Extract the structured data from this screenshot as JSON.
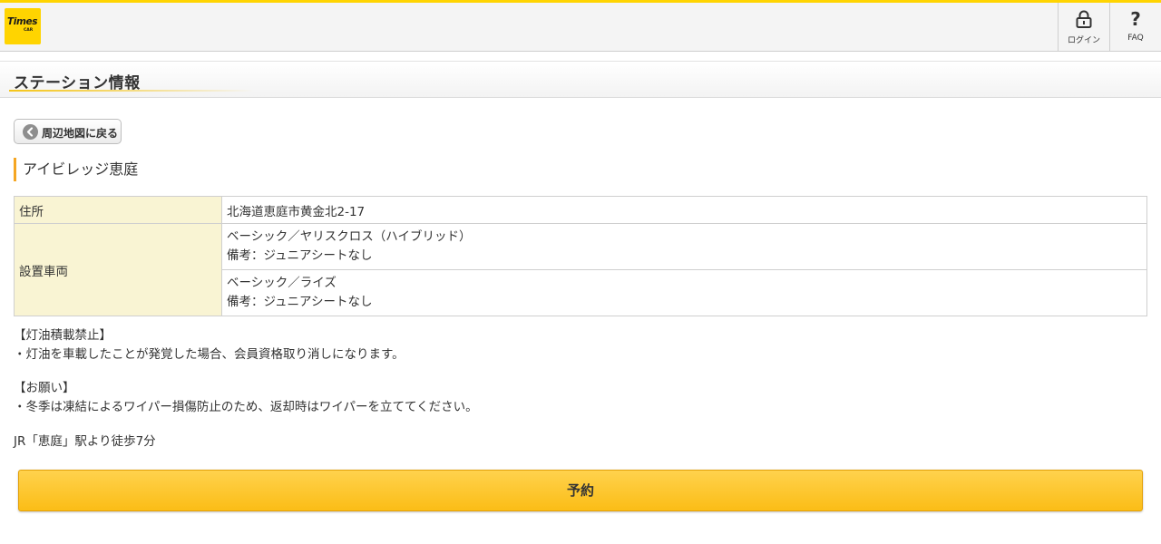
{
  "header": {
    "logo_text": "Times",
    "logo_sub": "CAR",
    "login_label": "ログイン",
    "faq_label": "FAQ",
    "faq_glyph": "?"
  },
  "page": {
    "title": "ステーション情報"
  },
  "back_button": {
    "label": "周辺地図に戻る"
  },
  "station": {
    "name": "アイビレッジ恵庭",
    "address_label": "住所",
    "address": "北海道恵庭市黄金北2-17",
    "vehicles_label": "設置車両",
    "vehicles": [
      {
        "model": "ベーシック／ヤリスクロス（ハイブリッド）",
        "note": "備考：ジュニアシートなし"
      },
      {
        "model": "ベーシック／ライズ",
        "note": "備考：ジュニアシートなし"
      }
    ]
  },
  "notices": [
    {
      "heading": "【灯油積載禁止】",
      "body": "・灯油を車載したことが発覚した場合、会員資格取り消しになります。"
    },
    {
      "heading": "【お願い】",
      "body": "・冬季は凍結によるワイパー損傷防止のため、返却時はワイパーを立ててください。"
    }
  ],
  "access": "JR「恵庭」駅より徒歩7分",
  "reserve_button": {
    "label": "予約"
  },
  "colors": {
    "brand_yellow": "#ffd400",
    "accent_orange": "#f5a623",
    "table_key_bg": "#f9f4d3",
    "button_gradient_top": "#ffd24d",
    "button_gradient_bottom": "#fbbd16"
  }
}
